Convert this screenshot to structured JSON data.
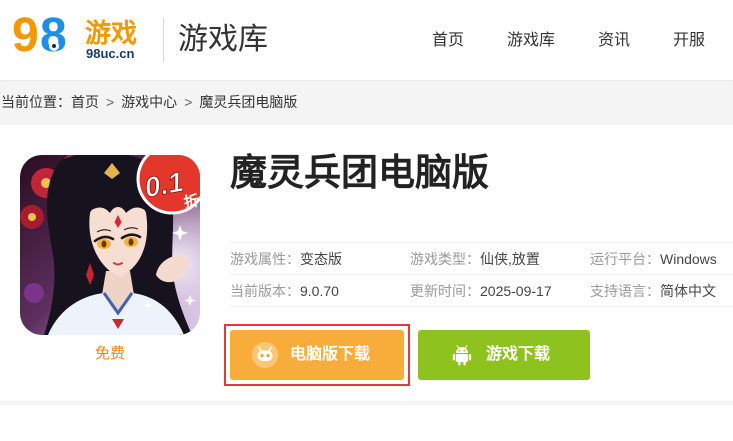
{
  "header": {
    "logo": {
      "digit_1": "9",
      "digit_2": "8",
      "name": "游戏",
      "domain": "98uc.cn"
    },
    "section_title": "游戏库",
    "nav": [
      "首页",
      "游戏库",
      "资讯",
      "开服"
    ]
  },
  "breadcrumb": {
    "prefix": "当前位置：",
    "separator": ">",
    "items": [
      "首页",
      "游戏中心",
      "魔灵兵团电脑版"
    ]
  },
  "game": {
    "title": "魔灵兵团电脑版",
    "icon": {
      "badge_value": "0.1",
      "badge_unit": "折"
    },
    "price": "免费",
    "info": [
      {
        "label": "游戏属性：",
        "value": "变态版"
      },
      {
        "label": "游戏类型：",
        "value": "仙侠,放置"
      },
      {
        "label": "运行平台：",
        "value": "Windows"
      },
      {
        "label": "当前版本：",
        "value": "9.0.70"
      },
      {
        "label": "更新时间：",
        "value": "2025-09-17"
      },
      {
        "label": "支持语言：",
        "value": "简体中文"
      }
    ],
    "buttons": {
      "pc_download": {
        "label": "电脑版下载",
        "icon": "emulator-robot-icon",
        "highlighted": true
      },
      "game_download": {
        "label": "游戏下载",
        "icon": "android-icon"
      }
    }
  },
  "colors": {
    "logo_orange": "#f39800",
    "logo_blue": "#1e8ee6",
    "price_orange": "#f08519",
    "pc_button": "#f8ad3a",
    "game_button": "#8dc21f",
    "highlight_border": "#e0393e",
    "page_background": "#f4f4f4"
  }
}
